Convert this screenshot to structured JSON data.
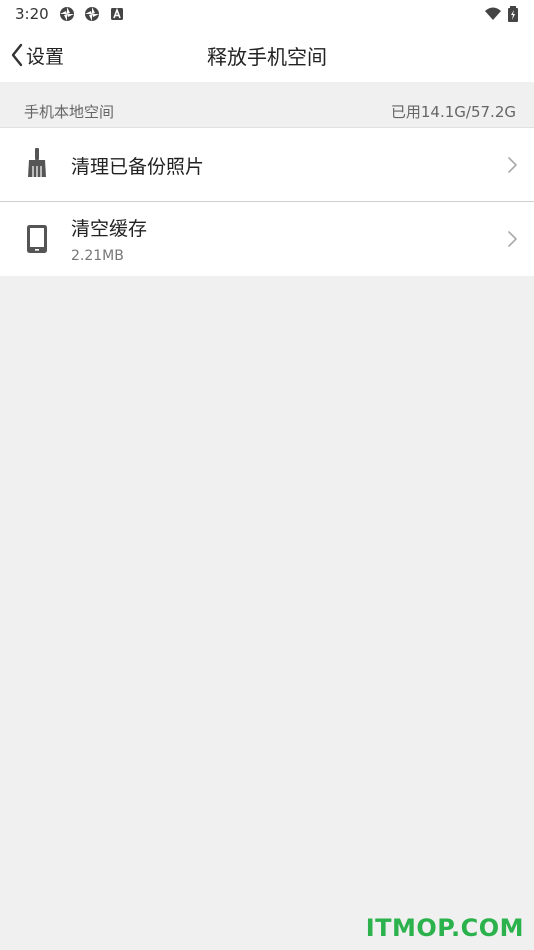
{
  "status_bar": {
    "time": "3:20",
    "icons": [
      "aperture-icon",
      "aperture-icon",
      "notification-a-icon",
      "wifi-icon",
      "battery-charging-icon"
    ]
  },
  "nav": {
    "back_label": "设置",
    "title": "释放手机空间"
  },
  "storage_section": {
    "label": "手机本地空间",
    "usage": "已用14.1G/57.2G"
  },
  "items": [
    {
      "title": "清理已备份照片",
      "icon": "broom-icon"
    },
    {
      "title": "清空缓存",
      "subtitle": "2.21MB",
      "icon": "phone-icon"
    }
  ],
  "watermark": "ITMOP.COM",
  "colors": {
    "background": "#f0f0f0",
    "card": "#ffffff",
    "watermark": "#2bb24c"
  }
}
